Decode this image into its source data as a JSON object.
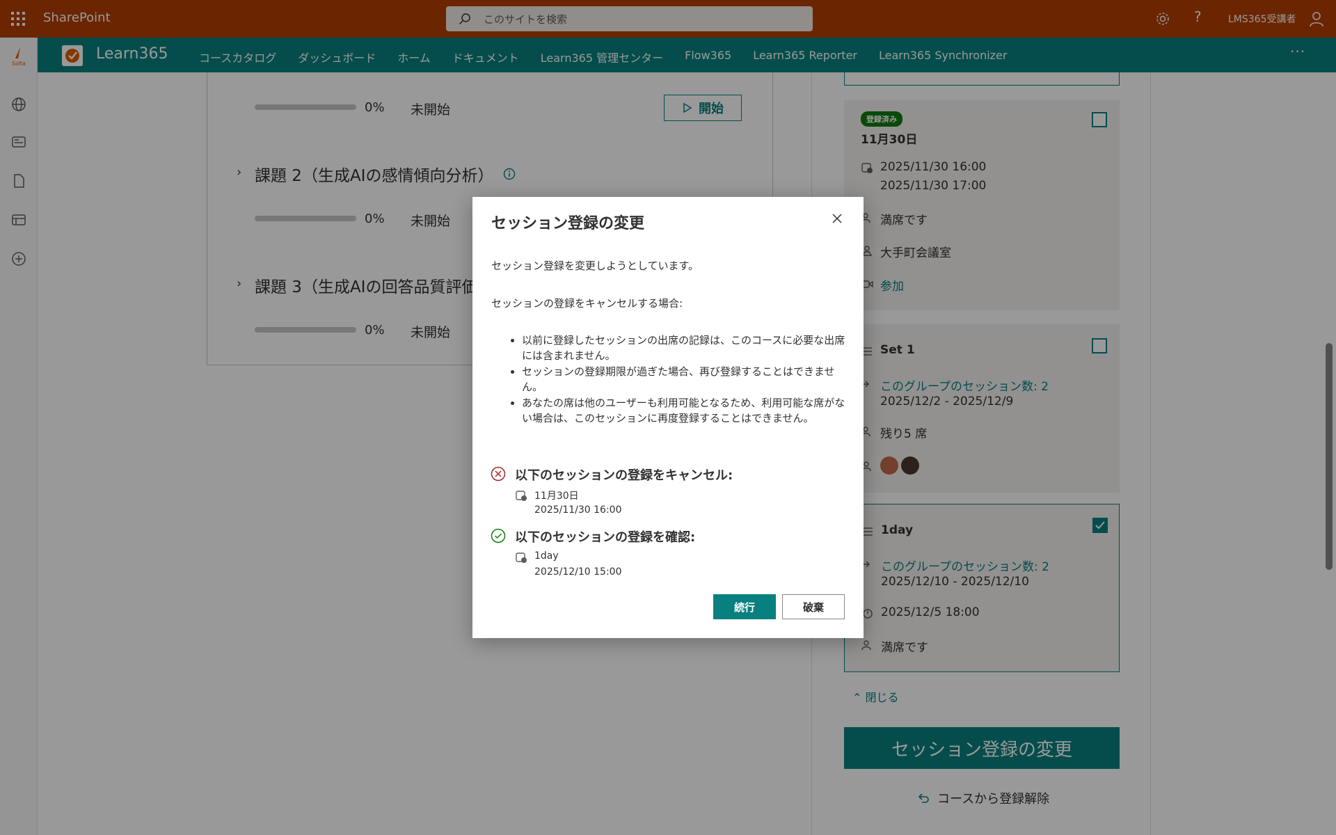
{
  "suite": {
    "brand": "SharePoint",
    "search_placeholder": "このサイトを検索",
    "username": "LMS365受講者"
  },
  "hub": {
    "title": "Learn365",
    "links": [
      "コースカタログ",
      "ダッシュボード",
      "ホーム",
      "ドキュメント",
      "Learn365 管理センター",
      "Flow365",
      "Learn365 Reporter",
      "Learn365 Synchronizer"
    ],
    "more": "···"
  },
  "tasks": {
    "row1": {
      "percent": "0%",
      "status": "未開始",
      "start_label": "開始"
    },
    "task2": {
      "title": "課題 2（生成AIの感情傾向分析）",
      "percent": "0%",
      "status": "未開始"
    },
    "task3": {
      "title": "課題 3（生成AIの回答品質評価",
      "percent": "0%",
      "status": "未開始"
    }
  },
  "sessions": {
    "s1": {
      "badge": "登録済み",
      "title": "11月30日",
      "start": "2025/11/30 16:00",
      "end": "2025/11/30 17:00",
      "capacity": "満席です",
      "location": "大手町会議室",
      "join": "参加"
    },
    "s2": {
      "title": "Set 1",
      "group_link": "このグループのセッション数: 2",
      "range": "2025/12/2 - 2025/12/9",
      "seats": "残り5 席"
    },
    "s3": {
      "title": "1day",
      "group_link": "このグループのセッション数: 2",
      "range": "2025/12/10 - 2025/12/10",
      "deadline": "2025/12/5 18:00",
      "capacity": "満席です"
    },
    "close_label": "閉じる",
    "change_button": "セッション登録の変更",
    "unregister": "コースから登録解除"
  },
  "dialog": {
    "title": "セッション登録の変更",
    "intro": "セッション登録を変更しようとしています。",
    "cancel_header": "セッションの登録をキャンセルする場合:",
    "bullets": [
      "以前に登録したセッションの出席の記録は、このコースに必要な出席には含まれません。",
      "セッションの登録期限が過ぎた場合、再び登録することはできません。",
      "あなたの席は他のユーザーも利用可能となるため、利用可能な席がない場合は、このセッションに再度登録することはできません。"
    ],
    "cancel_heading": "以下のセッションの登録をキャンセル:",
    "cancel_session": {
      "name": "11月30日",
      "time": "2025/11/30 16:00"
    },
    "confirm_heading": "以下のセッションの登録を確認:",
    "confirm_session": {
      "name": "1day",
      "time": "2025/12/10 15:00"
    },
    "continue_label": "続行",
    "discard_label": "破棄"
  },
  "colors": {
    "suite": "#b33e00",
    "hub": "#07807f",
    "accent": "#07807f",
    "badge": "#107c10",
    "error": "#a4262c",
    "success": "#107c10"
  },
  "icons": [
    "waffle-icon",
    "search-icon",
    "gear-icon",
    "help-icon",
    "person-icon",
    "globe-icon",
    "news-icon",
    "document-icon",
    "list-icon",
    "add-icon",
    "close-icon",
    "calendar-clock-icon",
    "people-icon",
    "location-icon",
    "video-icon",
    "link-icon",
    "alarm-icon",
    "error-circle-icon",
    "check-circle-icon",
    "play-icon",
    "undo-icon",
    "chevron-up-icon",
    "chevron-right-icon",
    "info-icon"
  ]
}
